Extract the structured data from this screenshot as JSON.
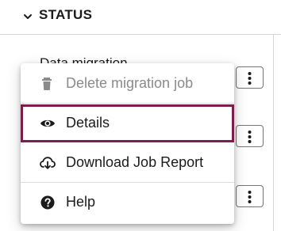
{
  "section": {
    "title": "STATUS"
  },
  "background_rows": [
    {
      "title": "Data migration"
    }
  ],
  "menu": {
    "items": [
      {
        "label": "Delete migration job",
        "icon": "trash-icon",
        "disabled": true
      },
      {
        "label": "Details",
        "icon": "eye-icon",
        "focused": true
      },
      {
        "label": "Download Job Report",
        "icon": "cloud-download-icon"
      },
      {
        "label": "Help",
        "icon": "question-circle-icon"
      }
    ]
  },
  "colors": {
    "focus_border": "#7a1f4a",
    "status_dot": "#1e7a3c",
    "disabled_text": "#8a8a8a"
  }
}
